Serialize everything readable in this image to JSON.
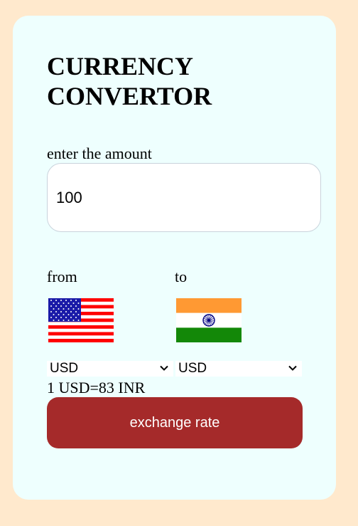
{
  "title": "CURRENCY CONVERTOR",
  "amount": {
    "label": "enter the amount",
    "value": "100"
  },
  "from": {
    "label": "from",
    "flag": "us-flag-icon",
    "currency": "USD"
  },
  "to": {
    "label": "to",
    "flag": "india-flag-icon",
    "currency": "USD"
  },
  "rate_text": "1 USD=83 INR",
  "button": {
    "label": "exchange rate",
    "color": "#a52a2a"
  },
  "colors": {
    "page_background": "#ffe9cd",
    "card_background": "#eefffe"
  }
}
